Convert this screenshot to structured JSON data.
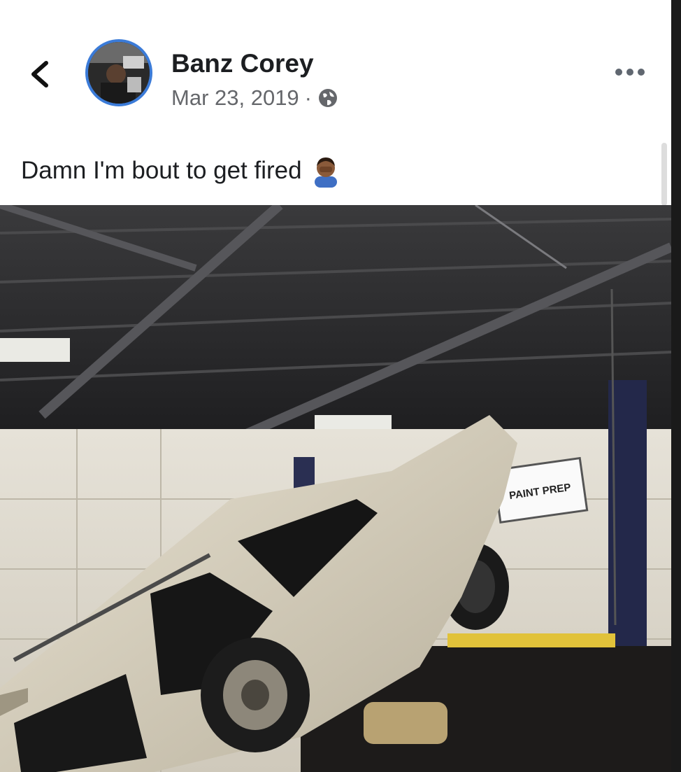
{
  "post": {
    "author": "Banz Corey",
    "date": "Mar 23, 2019",
    "separator": "·",
    "text": "Damn I'm bout to get fired",
    "privacy_icon": "globe-icon",
    "emoji_icon": "person-facepalming-emoji"
  },
  "photo": {
    "sign_text": "PAINT PREP"
  },
  "colors": {
    "avatar_ring": "#3b7bd8",
    "name": "#1c1e21",
    "meta": "#65676b"
  }
}
